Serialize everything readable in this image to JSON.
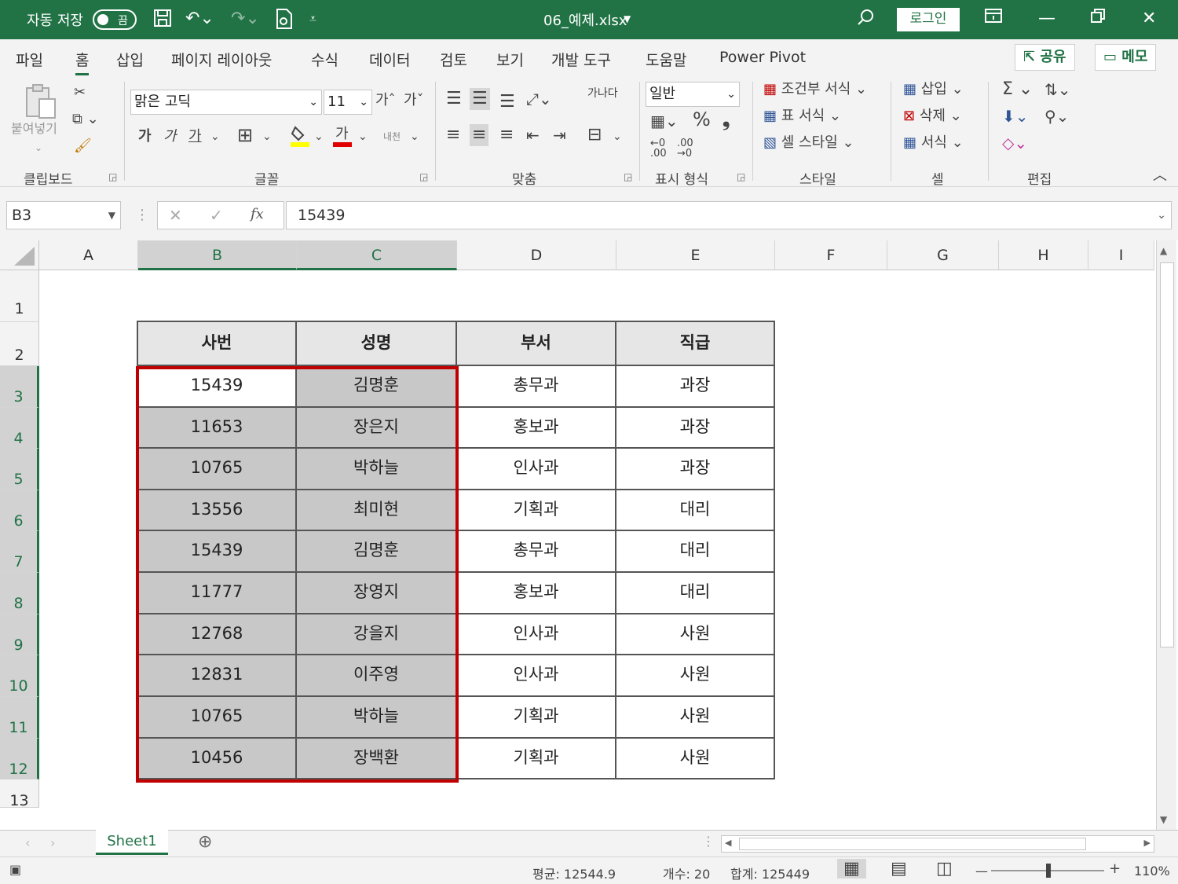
{
  "title_bar": {
    "autosave_label": "자동 저장",
    "autosave_state": "끔",
    "filename": "06_예제.xlsx",
    "login": "로그인"
  },
  "menu": {
    "tabs": [
      "파일",
      "홈",
      "삽입",
      "페이지 레이아웃",
      "수식",
      "데이터",
      "검토",
      "보기",
      "개발 도구",
      "도움말",
      "Power Pivot"
    ],
    "active_tab": "홈",
    "share": "공유",
    "memo": "메모"
  },
  "ribbon": {
    "clipboard": {
      "label": "클립보드",
      "paste": "붙여넣기"
    },
    "font": {
      "label": "글꼴",
      "name": "맑은 고딕",
      "size": "11",
      "bold": "가",
      "italic": "가",
      "underline": "가"
    },
    "alignment": {
      "label": "맞춤",
      "wrap": "가나다"
    },
    "number": {
      "label": "표시 형식",
      "format": "일반",
      "percent": "%",
      "comma": "❟"
    },
    "styles": {
      "label": "스타일",
      "conditional": "조건부 서식",
      "table": "표 서식",
      "cell": "셀 스타일"
    },
    "cells": {
      "label": "셀",
      "insert": "삽입",
      "delete": "삭제",
      "format": "서식"
    },
    "editing": {
      "label": "편집"
    }
  },
  "formula_bar": {
    "name_box": "B3",
    "fx": "fx",
    "value": "15439"
  },
  "columns": [
    "A",
    "B",
    "C",
    "D",
    "E",
    "F",
    "G",
    "H",
    "I"
  ],
  "rows": [
    "1",
    "2",
    "3",
    "4",
    "5",
    "6",
    "7",
    "8",
    "9",
    "10",
    "11",
    "12",
    "13"
  ],
  "table": {
    "headers": [
      "사번",
      "성명",
      "부서",
      "직급"
    ],
    "rows": [
      [
        "15439",
        "김명훈",
        "총무과",
        "과장"
      ],
      [
        "11653",
        "장은지",
        "홍보과",
        "과장"
      ],
      [
        "10765",
        "박하늘",
        "인사과",
        "과장"
      ],
      [
        "13556",
        "최미현",
        "기획과",
        "대리"
      ],
      [
        "15439",
        "김명훈",
        "총무과",
        "대리"
      ],
      [
        "11777",
        "장영지",
        "홍보과",
        "대리"
      ],
      [
        "12768",
        "강을지",
        "인사과",
        "사원"
      ],
      [
        "12831",
        "이주영",
        "인사과",
        "사원"
      ],
      [
        "10765",
        "박하늘",
        "기획과",
        "사원"
      ],
      [
        "10456",
        "장백환",
        "기획과",
        "사원"
      ]
    ]
  },
  "sheet_tab": "Sheet1",
  "status": {
    "average": "평균: 12544.9",
    "count": "개수: 20",
    "sum": "합계: 125449",
    "zoom": "110%"
  },
  "colors": {
    "excel_green": "#217346",
    "highlight_red": "#c00000",
    "selection_gray": "#c8c8c8"
  }
}
